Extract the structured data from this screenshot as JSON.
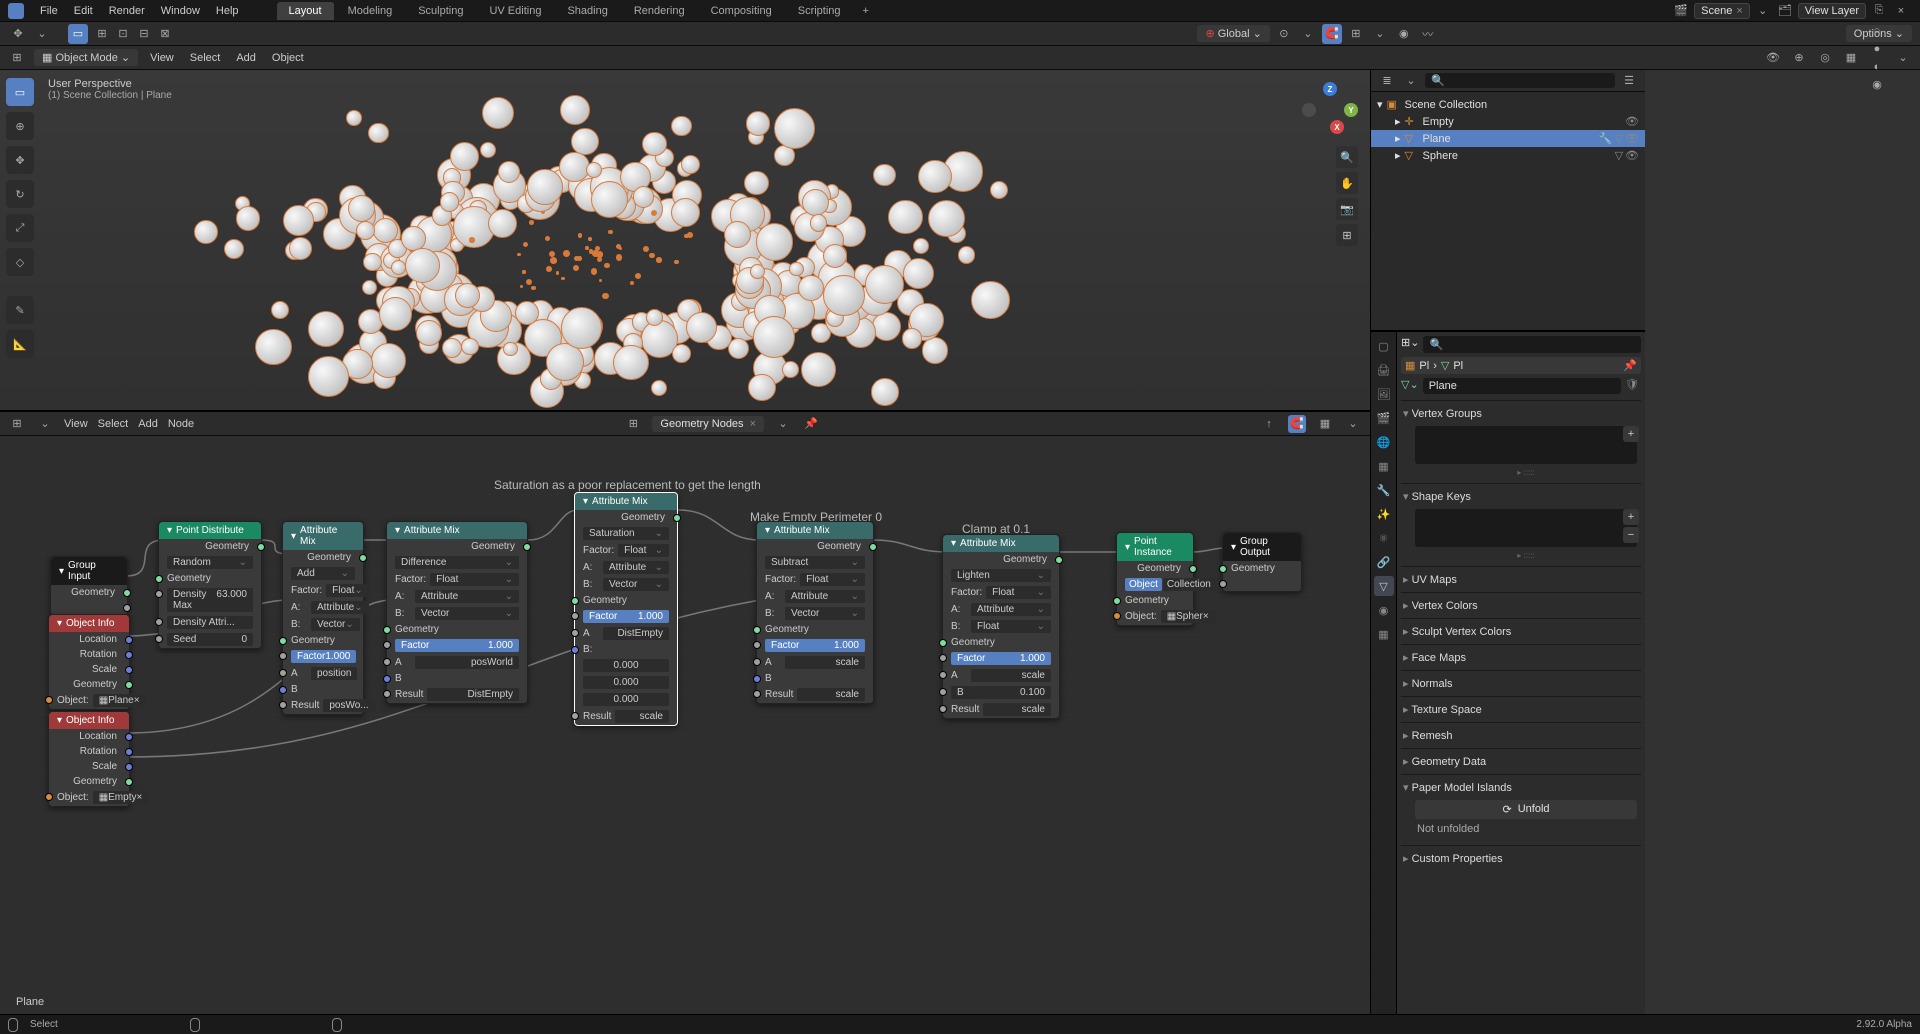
{
  "menus": [
    "File",
    "Edit",
    "Render",
    "Window",
    "Help"
  ],
  "workspaces": [
    "Layout",
    "Modeling",
    "Sculpting",
    "UV Editing",
    "Shading",
    "Rendering",
    "Compositing",
    "Scripting"
  ],
  "active_workspace": "Layout",
  "scene_field": "Scene",
  "view_layer_field": "View Layer",
  "toolbar2": {
    "orientation": "Global",
    "options": "Options"
  },
  "header": {
    "mode": "Object Mode",
    "menus": [
      "View",
      "Select",
      "Add",
      "Object"
    ]
  },
  "viewport": {
    "perspective": "User Perspective",
    "context": "(1) Scene Collection | Plane",
    "selection_label": "Plane"
  },
  "node_editor": {
    "menus": [
      "View",
      "Select",
      "Add",
      "Node"
    ],
    "tree_name": "Geometry Nodes",
    "frame1_label": "Saturation as a poor replacement to get the length",
    "frame2_label": "Make Empty Perimeter 0",
    "frame3_label": "Clamp at 0.1"
  },
  "nodes": {
    "group_input": {
      "title": "Group Input",
      "outputs": [
        "Geometry"
      ]
    },
    "object_info1": {
      "title": "Object Info",
      "outputs": [
        "Location",
        "Rotation",
        "Scale",
        "Geometry"
      ],
      "object": "Plane"
    },
    "object_info2": {
      "title": "Object Info",
      "outputs": [
        "Location",
        "Rotation",
        "Scale",
        "Geometry"
      ],
      "object": "Empty"
    },
    "point_distribute": {
      "title": "Point Distribute",
      "geometry_out": "Geometry",
      "mode": "Random",
      "geometry_in": "Geometry",
      "density_max_label": "Density Max",
      "density_max": "63.000",
      "density_attr_label": "Density Attri...",
      "seed_label": "Seed",
      "seed": "0"
    },
    "attr_mix_add": {
      "title": "Attribute Mix",
      "geometry_out": "Geometry",
      "blend": "Add",
      "factor_type": "Float",
      "a_type": "Attribute",
      "b_type": "Vector",
      "geometry_in": "Geometry",
      "factor": "1.000",
      "a": "position",
      "b": "",
      "result": "posWo..."
    },
    "attr_mix_diff": {
      "title": "Attribute Mix",
      "geometry_out": "Geometry",
      "blend": "Difference",
      "factor_type": "Float",
      "a_type": "Attribute",
      "b_type": "Vector",
      "geometry_in": "Geometry",
      "factor": "1.000",
      "a": "posWorld",
      "b": "",
      "result": "DistEmpty"
    },
    "attr_mix_sat": {
      "title": "Attribute Mix",
      "geometry_out": "Geometry",
      "blend": "Saturation",
      "factor_type": "Float",
      "a_type": "Attribute",
      "b_type": "Vector",
      "geometry_in": "Geometry",
      "factor": "1.000",
      "a": "DistEmpty",
      "b0": "0.000",
      "b1": "0.000",
      "b2": "0.000",
      "result": "scale"
    },
    "attr_mix_sub": {
      "title": "Attribute Mix",
      "geometry_out": "Geometry",
      "blend": "Subtract",
      "factor_type": "Float",
      "a_type": "Attribute",
      "b_type": "Vector",
      "geometry_in": "Geometry",
      "factor": "1.000",
      "a": "scale",
      "b": "",
      "result": "scale"
    },
    "attr_mix_light": {
      "title": "Attribute Mix",
      "geometry_out": "Geometry",
      "blend": "Lighten",
      "factor_type": "Float",
      "a_type": "Attribute",
      "b_type": "Float",
      "geometry_in": "Geometry",
      "factor": "1.000",
      "a": "scale",
      "b": "0.100",
      "result": "scale"
    },
    "point_instance": {
      "title": "Point Instance",
      "geometry_out": "Geometry",
      "toggle_object": "Object",
      "toggle_collection": "Collection",
      "geometry_in": "Geometry",
      "object_label": "Object:",
      "object": "Spher"
    },
    "group_output": {
      "title": "Group Output",
      "geometry": "Geometry"
    }
  },
  "outliner": {
    "root": "Scene Collection",
    "items": [
      {
        "name": "Empty",
        "active": false
      },
      {
        "name": "Plane",
        "active": true
      },
      {
        "name": "Sphere",
        "active": false
      }
    ]
  },
  "properties": {
    "breadcrumb1": "Pl",
    "breadcrumb2": "Pl",
    "name": "Plane",
    "sections": [
      "Vertex Groups",
      "Shape Keys",
      "UV Maps",
      "Vertex Colors",
      "Sculpt Vertex Colors",
      "Face Maps",
      "Normals",
      "Texture Space",
      "Remesh",
      "Geometry Data",
      "Paper Model Islands",
      "Custom Properties"
    ],
    "unfold": "Unfold",
    "unfold_status": "Not unfolded"
  },
  "statusbar": {
    "select": "Select",
    "version": "2.92.0 Alpha"
  }
}
